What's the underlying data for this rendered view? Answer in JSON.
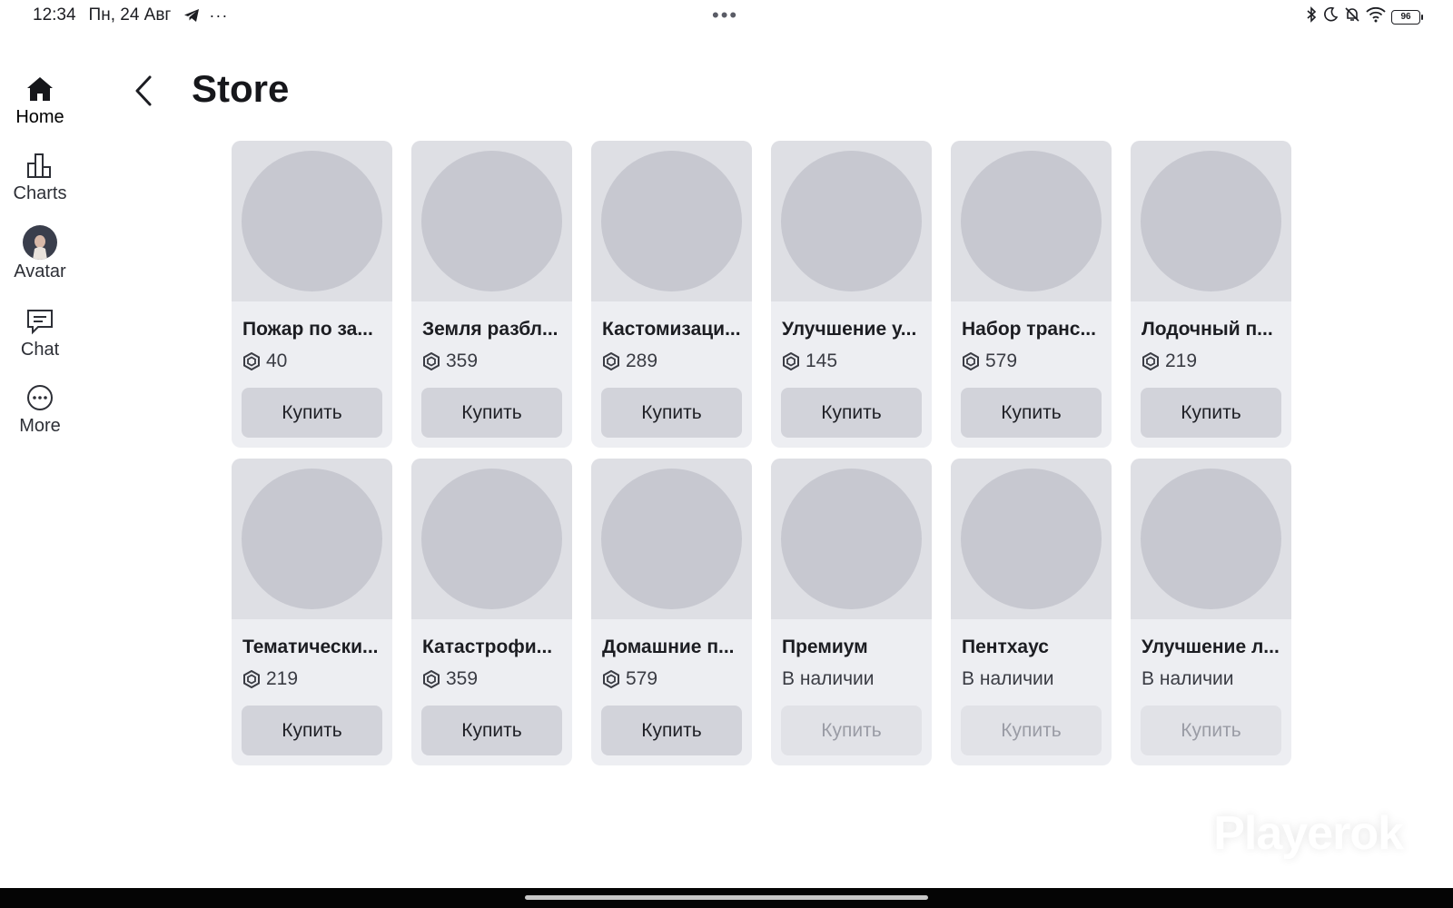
{
  "status_bar": {
    "time": "12:34",
    "date": "Пн, 24 Авг",
    "more": "···",
    "center_dots": "•••",
    "battery": "96"
  },
  "sidebar": {
    "items": [
      {
        "label": "Home",
        "icon": "home-icon"
      },
      {
        "label": "Charts",
        "icon": "charts-icon"
      },
      {
        "label": "Avatar",
        "icon": "avatar-icon"
      },
      {
        "label": "Chat",
        "icon": "chat-icon"
      },
      {
        "label": "More",
        "icon": "more-icon"
      }
    ]
  },
  "header": {
    "title": "Store"
  },
  "store": {
    "items": [
      {
        "name": "Пожар по за...",
        "price": "40",
        "button": "Купить"
      },
      {
        "name": "Земля разбл...",
        "price": "359",
        "button": "Купить"
      },
      {
        "name": "Кастомизаци...",
        "price": "289",
        "button": "Купить"
      },
      {
        "name": "Улучшение у...",
        "price": "145",
        "button": "Купить"
      },
      {
        "name": "Набор транс...",
        "price": "579",
        "button": "Купить"
      },
      {
        "name": "Лодочный п...",
        "price": "219",
        "button": "Купить"
      },
      {
        "name": "Тематически...",
        "price": "219",
        "button": "Купить"
      },
      {
        "name": "Катастрофи...",
        "price": "359",
        "button": "Купить"
      },
      {
        "name": "Домашние п...",
        "price": "579",
        "button": "Купить"
      },
      {
        "name": "Премиум",
        "status": "В наличии",
        "button": "Купить"
      },
      {
        "name": "Пентхаус",
        "status": "В наличии",
        "button": "Купить"
      },
      {
        "name": "Улучшение л...",
        "status": "В наличии",
        "button": "Купить"
      }
    ]
  },
  "watermark": "Playerok"
}
